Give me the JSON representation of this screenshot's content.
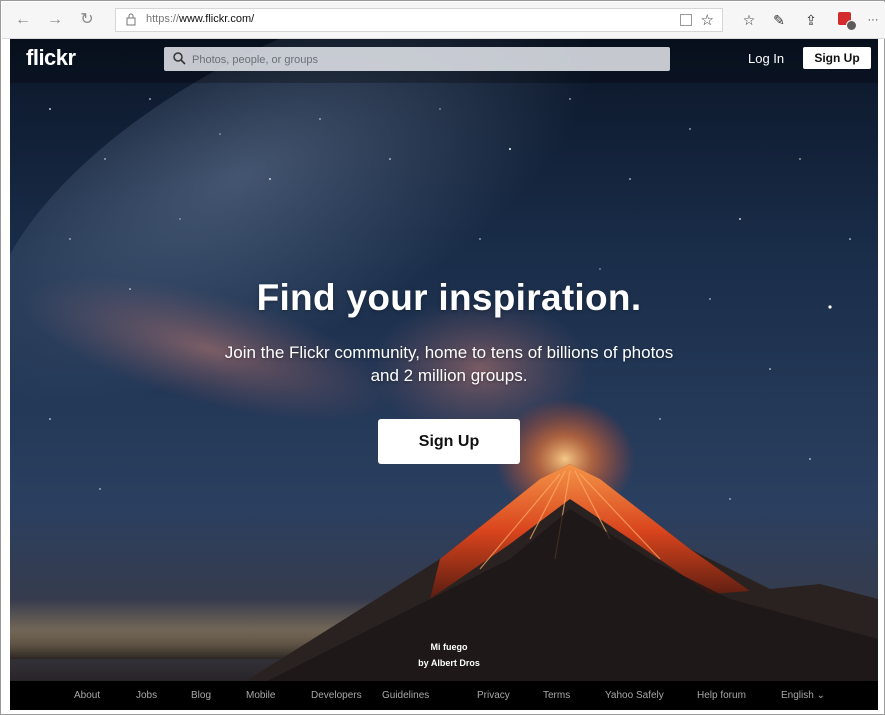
{
  "browser": {
    "url_prefix": "https://",
    "url_host": "www.flickr.com/",
    "back_icon": "←",
    "forward_icon": "→",
    "refresh_icon": "↻",
    "star_icon": "☆",
    "favorites_icon": "☆",
    "pen_icon": "✎",
    "share_icon": "⇪",
    "more_icon": "···"
  },
  "header": {
    "logo": "flickr",
    "search_placeholder": "Photos, people, or groups",
    "login_label": "Log In",
    "signup_label": "Sign Up"
  },
  "hero": {
    "title": "Find your inspiration.",
    "subtitle": "Join the Flickr community, home to tens of billions of photos and 2 million groups.",
    "cta_label": "Sign Up"
  },
  "credit": {
    "photo_title": "Mi fuego",
    "author": "by Albert Dros"
  },
  "footer": {
    "links": [
      "About",
      "Jobs",
      "Blog",
      "Mobile",
      "Developers",
      "Guidelines",
      "Privacy",
      "Terms",
      "Yahoo Safely",
      "Help forum",
      "English ⌄"
    ]
  },
  "colors": {
    "sky_top": "#0e1a2e",
    "lava": "#e2461d",
    "footer_bg": "#000000"
  }
}
